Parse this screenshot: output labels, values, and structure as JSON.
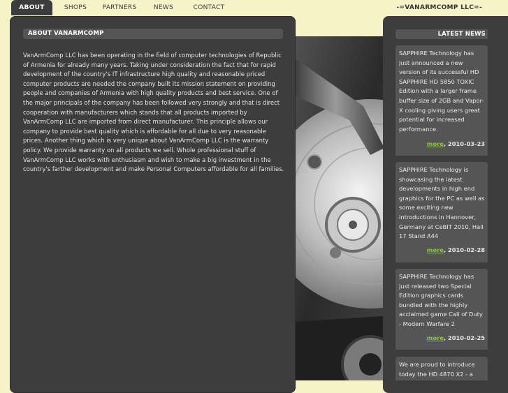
{
  "nav": {
    "items": [
      {
        "label": "ABOUT",
        "active": true
      },
      {
        "label": "SHOPS",
        "active": false
      },
      {
        "label": "PARTNERS",
        "active": false
      },
      {
        "label": "NEWS",
        "active": false
      },
      {
        "label": "CONTACT",
        "active": false
      }
    ],
    "brand": "-=VANARMCOMP LLC=-"
  },
  "about": {
    "title": "ABOUT VANARMCOMP",
    "text": "VanArmComp LLC has been operating in the field of computer technologies of Republic of Armenia for already many years. Taking under consideration the fact that for rapid development of the country's IT infrastructure high quality and reasonable priced computer products are needed the company built its mission statement on providing people and companies of Armenia with high quality products and best service. One of the major principals of the company has been followed very strongly and that is direct cooperation with manufacturers which stands that all products imported by VanArmComp LLC are imported from direct manufacturer. This principle allows our company to provide best quality which is affordable for all due to very reasonable prices. Another thing which is very unique about VanArmComp LLC is the warranty policy. We provide warranty on all products we sell. Whole professional stuff of VanArmComp LLC works with enthusiasm and wish to make a big investment in the country's farther development and make Personal Computers affordable for all families."
  },
  "news": {
    "title": "LATEST NEWS",
    "items": [
      {
        "text": "SAPPHIRE Technology has just announced a new version of its successful HD SAPPHIRE HD 5850 TOXIC Edition with a larger frame buffer size of 2GB and Vapor-X cooling giving users great potential for increased performance.",
        "more": "more",
        "date": ", 2010-03-23"
      },
      {
        "text": "SAPPHIRE Technology is showcasing the latest developments in high end graphics for the PC as well as some exciting new introductions in Hannover, Germany at CeBIT 2010, Hall 17 Stand A44",
        "more": "more",
        "date": ", 2010-02-28"
      },
      {
        "text": "SAPPHIRE Technology has just released two Special Edition graphics cards bundled with the highly acclaimed game Call of Duty - Modern Warfare 2",
        "more": "more",
        "date": ", 2010-02-25"
      },
      {
        "text": "We are proud to introduce today the HD 4870 X2 - a",
        "more": "",
        "date": ""
      }
    ]
  },
  "colors": {
    "page_bg": "#f7f3c9",
    "panel_bg": "#3d3d3d",
    "title_bg": "#555555",
    "more_link": "#8dc63f"
  }
}
